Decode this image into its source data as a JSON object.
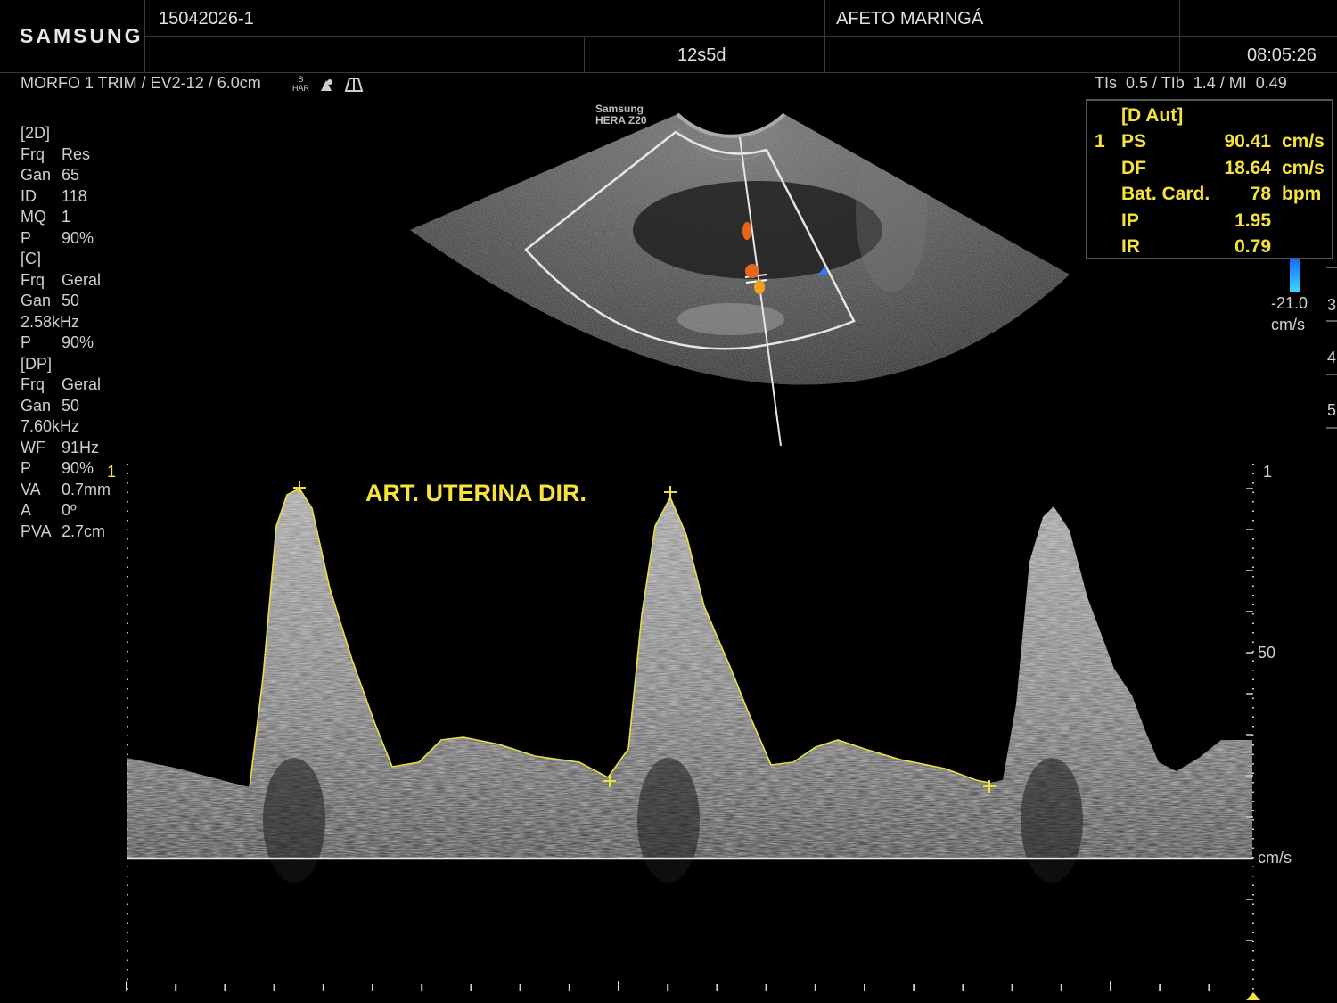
{
  "header": {
    "brand": "SAMSUNG",
    "patient_id": "15042026-1",
    "institution": "AFETO MARINGÁ",
    "gestational_age": "12s5d",
    "time": "08:05:26"
  },
  "info_bar": {
    "preset": "MORFO 1 TRIM / EV2-12 / 6.0cm",
    "har_label": "S\nHAR",
    "thermal": "TIs  0.5 / TIb  1.4 / MI  0.49"
  },
  "probe_label": {
    "line1": "Samsung",
    "line2": "HERA Z20"
  },
  "params": [
    {
      "k": "[2D]",
      "v": ""
    },
    {
      "k": "Frq",
      "v": "Res"
    },
    {
      "k": "Gan",
      "v": "65"
    },
    {
      "k": "ID",
      "v": "118"
    },
    {
      "k": "MQ",
      "v": "1"
    },
    {
      "k": "P",
      "v": "90%"
    },
    {
      "k": "[C]",
      "v": ""
    },
    {
      "k": "Frq",
      "v": "Geral"
    },
    {
      "k": "Gan",
      "v": "50"
    },
    {
      "k": "2.58kHz",
      "v": ""
    },
    {
      "k": "P",
      "v": "90%"
    },
    {
      "k": "[DP]",
      "v": ""
    },
    {
      "k": "Frq",
      "v": "Geral"
    },
    {
      "k": "Gan",
      "v": "50"
    },
    {
      "k": "7.60kHz",
      "v": ""
    },
    {
      "k": "WF",
      "v": "91Hz"
    },
    {
      "k": "P",
      "v": "90%"
    },
    {
      "k": "VA",
      "v": "0.7mm"
    },
    {
      "k": "A",
      "v": "0º"
    },
    {
      "k": "PVA",
      "v": "2.7cm"
    }
  ],
  "measurements": {
    "header": "[D Aut]",
    "index": "1",
    "rows": [
      {
        "label": "PS",
        "value": "90.41",
        "unit": "cm/s"
      },
      {
        "label": "DF",
        "value": "18.64",
        "unit": "cm/s"
      },
      {
        "label": "Bat. Card.",
        "value": "78",
        "unit": "bpm"
      },
      {
        "label": "IP",
        "value": "1.95",
        "unit": ""
      },
      {
        "label": "IR",
        "value": "0.79",
        "unit": ""
      }
    ]
  },
  "color_scale": {
    "min_value": "-21.0",
    "unit": "cm/s",
    "edge_ticks": [
      "3",
      "4",
      "5"
    ]
  },
  "doppler": {
    "annotation": "ART. UTERINA DIR.",
    "scale_top": "1",
    "scale_mid": "50",
    "scale_unit": "cm/s",
    "left_marker": "1"
  },
  "colors": {
    "background": "#000000",
    "annotation": "#f5e23a",
    "envelope": "#e8e23a",
    "flow_red": "#e8661a",
    "flow_blue": "#2a7cff"
  }
}
